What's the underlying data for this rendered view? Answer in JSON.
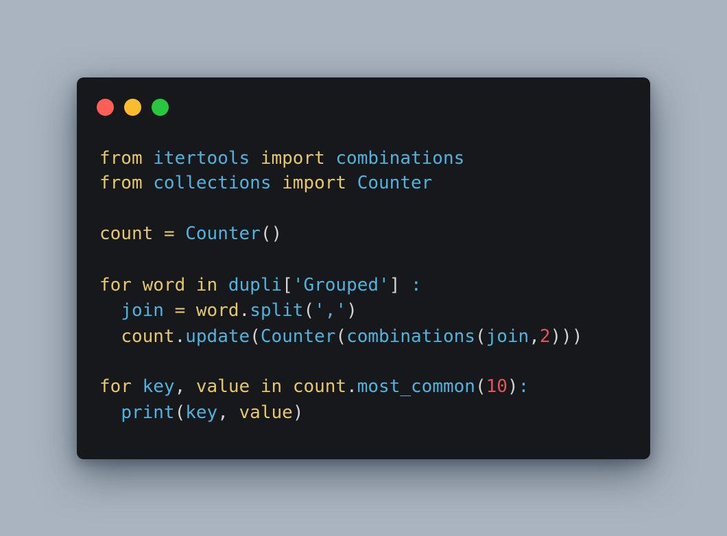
{
  "window": {
    "buttons": {
      "close_color": "#fb5f57",
      "minimize_color": "#fdbc2e",
      "maximize_color": "#27c840"
    }
  },
  "code": {
    "lines": [
      "from itertools import combinations",
      "from collections import Counter",
      "",
      "count = Counter()",
      "",
      "for word in dupli['Grouped'] :",
      "  join = word.split(',')",
      "  count.update(Counter(combinations(join,2)))",
      "",
      "for key, value in count.most_common(10):",
      "  print(key, value)"
    ]
  },
  "colors": {
    "background": "#a9b4c0",
    "editor": "#16181b",
    "keyword": "#e6c76a",
    "identifier": "#4fb3dd",
    "number": "#e0565b",
    "punctuation": "#d4d4d4"
  }
}
